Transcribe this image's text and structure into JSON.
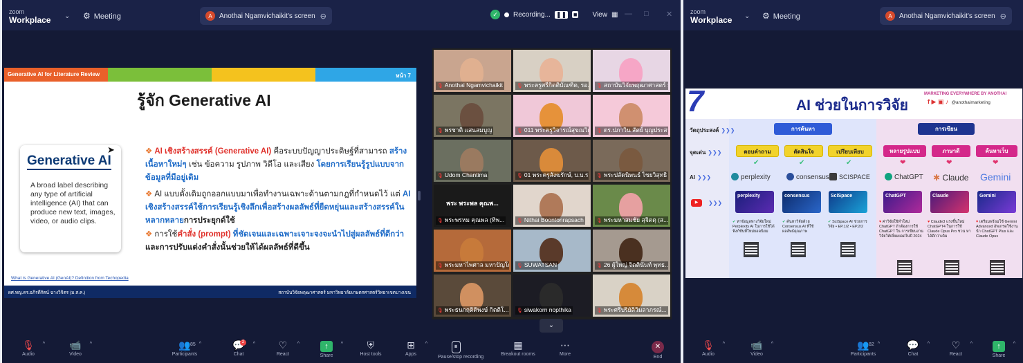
{
  "left": {
    "app": {
      "brand_line1": "zoom",
      "brand_line2": "Workplace",
      "meeting_label": "Meeting"
    },
    "screen_share": {
      "label": "Anothai Ngamvichaikit's screen"
    },
    "recording": {
      "label": "Recording...",
      "view_label": "View"
    },
    "slide": {
      "topic": "Generative AI for Literature Review",
      "page": "หน้า 7",
      "title": "รู้จัก Generative AI",
      "card_heading": "Generative AI",
      "card_body": "A broad label describing any type of artificial intelligence (AI) that can produce new text, images, video, or audio clips.",
      "b1_red": "AI เชิงสร้างสรรค์ (Generative AI)",
      "b1_rest": " คือระบบปัญญาประดิษฐ์ที่สามารถ",
      "b1_blue1": "สร้างเนื้อหาใหม่ๆ",
      "b1_mid": " เช่น ข้อความ รูปภาพ วิดีโอ และเสียง ",
      "b1_blue2": "โดยการเรียนรู้รูปแบบจากข้อมูลที่มีอยู่เดิม",
      "b2_a": "AI แบบดั้งเดิมถูกออกแบบมาเพื่อทำงานเฉพาะด้านตามกฎที่กำหนดไว้ แต่ ",
      "b2_blue": "AI เชิงสร้างสรรค์ใช้การเรียนรู้เชิงลึกเพื่อสร้างผลลัพธ์ที่ยืดหยุ่นและสร้างสรรค์ในหลากหลาย",
      "b2_b": "การประยุกต์ใช้",
      "b3_a": "การใช้",
      "b3_red": "คำสั่ง (prompt)",
      "b3_blue": " ที่ชัดเจนและเฉพาะเจาะจงจะนำไปสู่ผลลัพธ์ที่ดีกว่า",
      "b3_b": "และการปรับแต่งคำสั่งนั้นช่วยให้ได้ผลลัพธ์ที่ดีขึ้น",
      "link": "What is Generative AI (GenAI)? Definition from Techopedia",
      "footer_left": "ผศ.ทญ.ดร.อภิรดีรัตน์ ฉางวิจิตร (ม.ส.ค.)",
      "footer_right": "สถาบันวิจัยพฤฒาศาสตร์ มหาวิทยาลัยเกษตรศาสตร์วิทยาเขตบางเขน"
    },
    "participants": [
      {
        "name": "Anothai Ngamvichaikit"
      },
      {
        "name": "พระครูศรีกิตติบัณฑิต, รอ..."
      },
      {
        "name": "สถาบันวิจัยพฤฒาศาสตร์ ม..."
      },
      {
        "name": "พรชาติ แสนสมบูญ"
      },
      {
        "name": "011 พระครูวิจารณ์สุขณวิต"
      },
      {
        "name": "ดร.ปภาวิน สัตย์ บุญประสาร"
      },
      {
        "name": "Udom Chantima"
      },
      {
        "name": "01 พระครูสังฆรักษ์, บ.บ.ร"
      },
      {
        "name": "พระปลัดนิพนธ์ ไชยวิสุทธิ"
      },
      {
        "name": "พระพรหม คุณพล (ทิพ..."
      },
      {
        "name": "Nithai Boontonrapsach"
      },
      {
        "name": "พระมหาสมชัย สุจิตตุ (ส..."
      },
      {
        "name": "พระมหาไพศาล มหาปัญโญ"
      },
      {
        "name": "SUWATSAN"
      },
      {
        "name": "26 ผู้ใหญ่ จิตตินันท์ พุทธ..."
      },
      {
        "name": "พระธนกฤติติพงษ์ กิตติโ..."
      },
      {
        "name": "siwakorn nopthika"
      },
      {
        "name": "พระศรีปริยัติวิมลาภรณ์..."
      }
    ],
    "tile_banner": "พระ พระพล คุณพ...",
    "toolbar": [
      {
        "label": "Audio"
      },
      {
        "label": "Video"
      },
      {
        "label": "Participants",
        "count": "85"
      },
      {
        "label": "Chat",
        "badge": "2"
      },
      {
        "label": "React"
      },
      {
        "label": "Share"
      },
      {
        "label": "Host tools"
      },
      {
        "label": "Apps"
      },
      {
        "label": "Pause/stop recording"
      },
      {
        "label": "Breakout rooms"
      },
      {
        "label": "More"
      },
      {
        "label": "End"
      }
    ]
  },
  "right": {
    "app": {
      "brand_line1": "zoom",
      "brand_line2": "Workplace",
      "meeting_label": "Meeting"
    },
    "screen_share": {
      "label": "Anothai Ngamvichaikit's screen"
    },
    "slide": {
      "number": "7",
      "title": "AI ช่วยในการวิจัย",
      "marketing": "MARKETING EVERYWHERE BY ANOTHAI",
      "handle": "@anothaimarketing",
      "row_objective": "วัตถุประสงค์",
      "row_highlight": "จุดเด่น",
      "row_ai": "AI",
      "obj_search": "การค้นหา",
      "obj_write": "การเขียน",
      "h1": "ตอบคำถาม",
      "h2": "ตัดสินใจ",
      "h3": "เปรียบเทียบ",
      "h4": "หลายรูปแบบ",
      "h5": "ภาษาดี",
      "h6": "ค้นหาเว็บ",
      "ai1": "perplexity",
      "ai2": "consensus",
      "ai3": "SCISPACE",
      "ai4": "ChatGPT",
      "ai5": "Claude",
      "ai6": "Gemini",
      "t1": "perplexity",
      "t2": "consensus",
      "t3": "SciSpace",
      "t4": "ChatGPT",
      "t5": "Claude",
      "t6": "Gemini",
      "n1": "หาข้อมูลทางวิจัยใหม่ Perplexity AI ในการใช้ได้ฟังก์ชันที่ใหม่ยอดนิยม",
      "n2": "ค้นหาวิจัยด้วย Consensus AI ที่ใช้ผลลัพธ์คุณภาพ",
      "n3": "SciSpace AI ช่วยการวิจัย • EP.1/2 • EP.2/2",
      "n4": "ค่าวิจัยใช้ทำใหม่ ChatGPT ถ้าต้องการใช้ ChatGPT ใน การเขียนงานวิจัยให้เยี่ยมยอดในปี 2024",
      "n5": "Claude3 แรงขึ้นใหม่ ChatGPT4 ในการใช้ Claude Opus Pro ชวน หาได้ดีกว่าเดิม",
      "n6": "เตรียมพร้อมใช้ Gemini Advanced อัพเกรดใช้งานนำ ChatGPT Plus และ Claude Opus"
    },
    "toolbar": [
      {
        "label": "Audio"
      },
      {
        "label": "Video"
      },
      {
        "label": "Participants",
        "count": "82"
      },
      {
        "label": "Chat"
      },
      {
        "label": "React"
      },
      {
        "label": "Share"
      }
    ]
  }
}
